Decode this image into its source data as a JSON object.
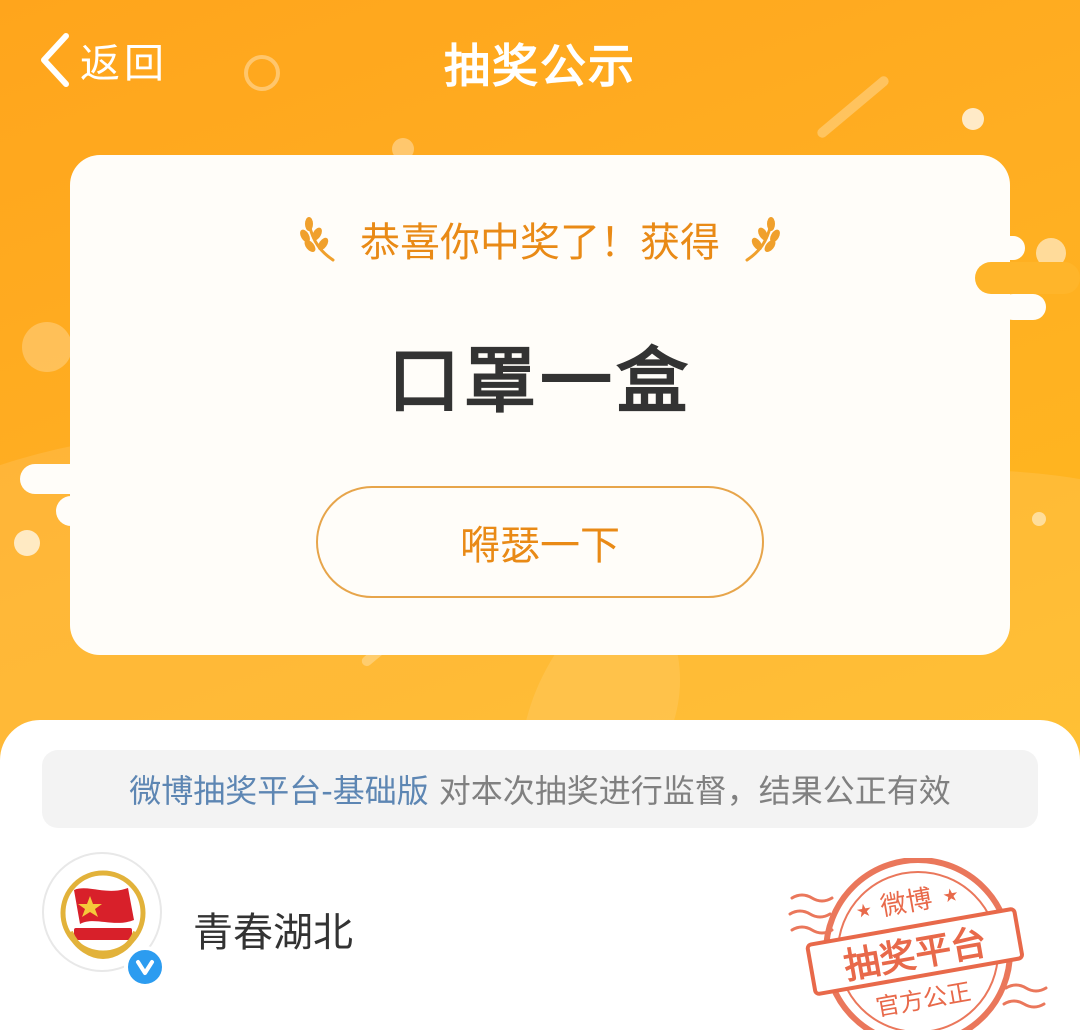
{
  "header": {
    "back_label": "返回",
    "title": "抽奖公示"
  },
  "result": {
    "congrats": "恭喜你中奖了！获得",
    "prize": "口罩一盒",
    "show_button": "嘚瑟一下"
  },
  "notice": {
    "platform": "微博抽奖平台-基础版",
    "text": "对本次抽奖进行监督，结果公正有效"
  },
  "publisher": {
    "name": "青春湖北",
    "verified": true
  },
  "stamp": {
    "top": "微博",
    "middle": "抽奖平台",
    "bottom": "官方公正"
  },
  "colors": {
    "background": "#ffae22",
    "accent": "#e98a16",
    "platform_link": "#5d86b3",
    "verified": "#2c9cf0",
    "stamp": "#e8694a"
  },
  "icons": {
    "back": "chevron-left-icon",
    "wheat": "wheat-icon",
    "verified": "verified-badge-icon",
    "avatar": "youth-league-emblem"
  }
}
